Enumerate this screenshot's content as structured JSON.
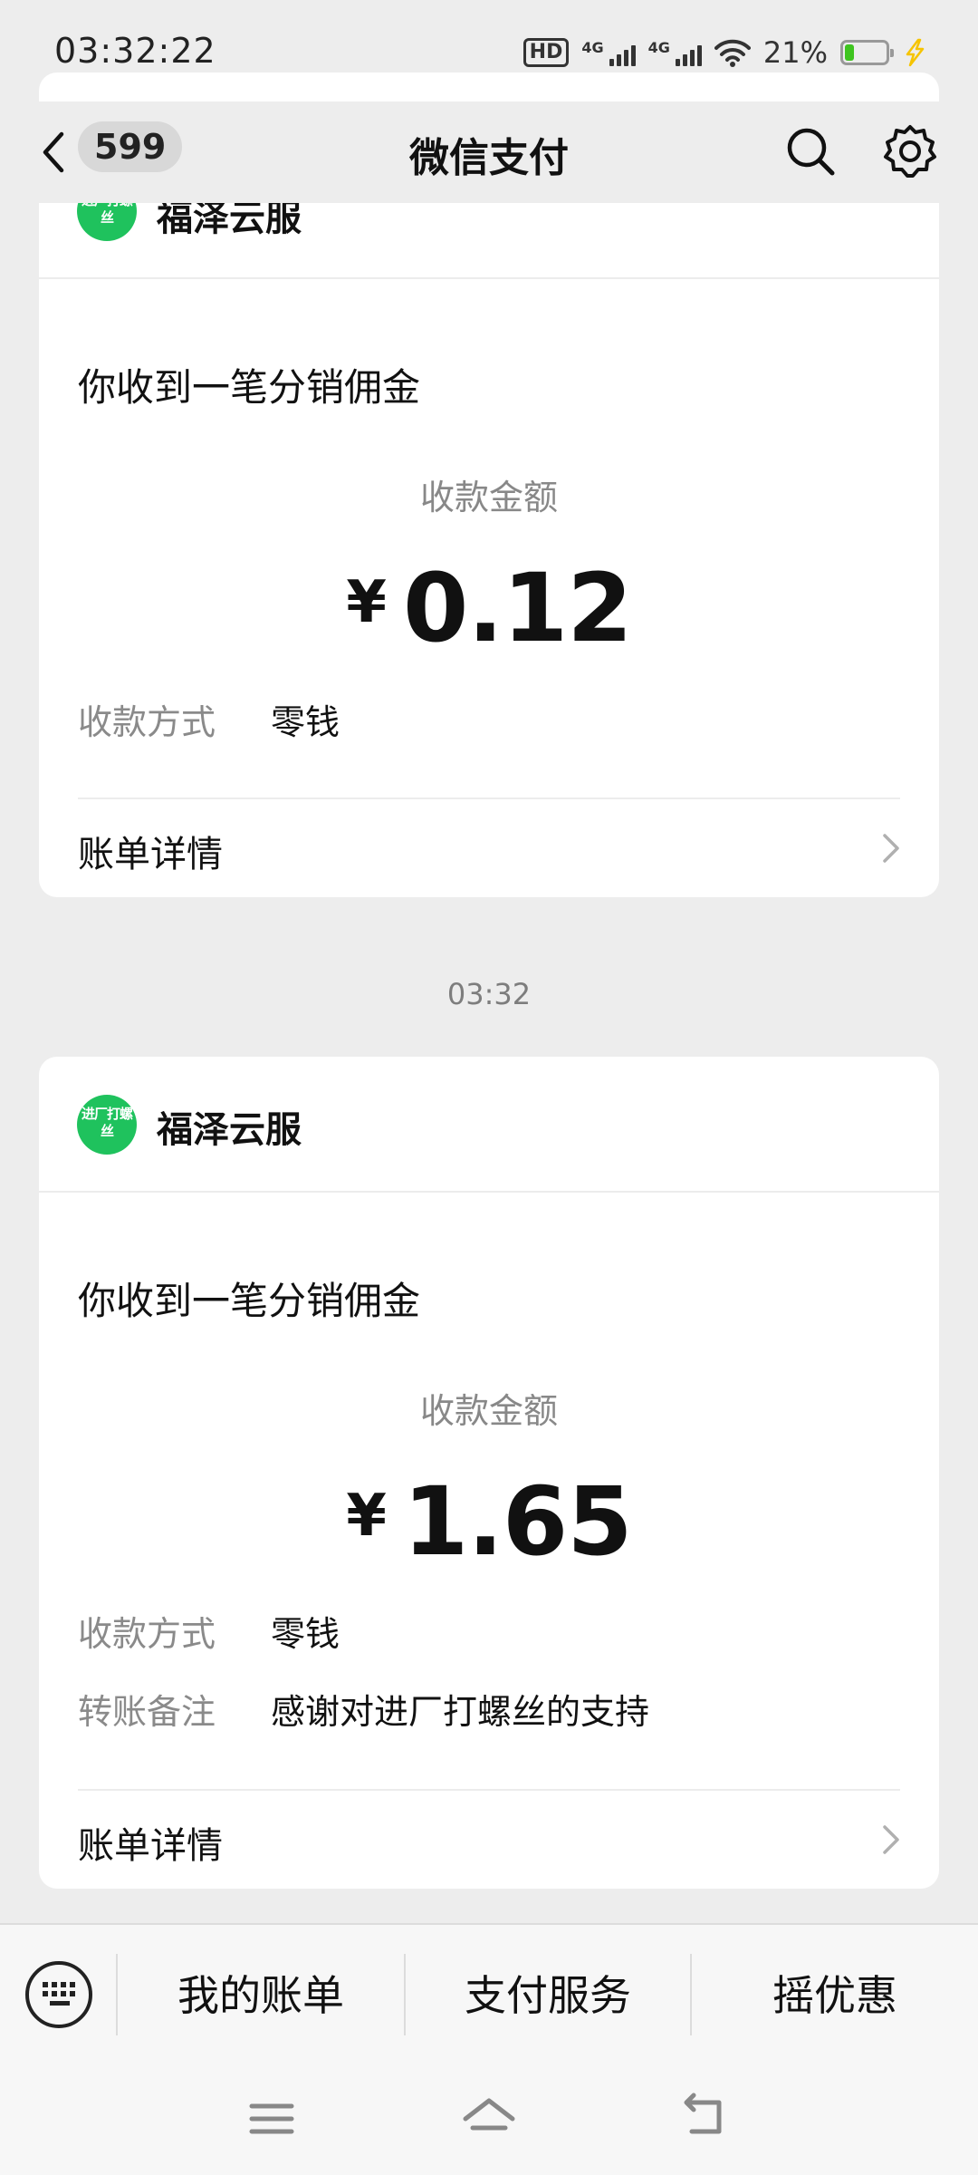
{
  "status_bar": {
    "time": "03:32:22",
    "hd_label": "HD",
    "net1": "4G",
    "net2": "4G",
    "battery_text": "21%",
    "battery_level": 0.21
  },
  "nav": {
    "back_count": "599",
    "title": "微信支付"
  },
  "cards": [
    {
      "merchant_logo_text": "进厂打螺丝",
      "merchant": "福泽云服",
      "title": "你收到一笔分销佣金",
      "amount_label": "收款金额",
      "currency": "¥",
      "amount": "0.12",
      "method_label": "收款方式",
      "method": "零钱",
      "detail_label": "账单详情"
    },
    {
      "merchant_logo_text": "进厂打螺丝",
      "merchant": "福泽云服",
      "title": "你收到一笔分销佣金",
      "amount_label": "收款金额",
      "currency": "¥",
      "amount": "1.65",
      "method_label": "收款方式",
      "method": "零钱",
      "note_label": "转账备注",
      "note": "感谢对进厂打螺丝的支持",
      "detail_label": "账单详情"
    }
  ],
  "time_separator": "03:32",
  "bottom_menu": [
    "我的账单",
    "支付服务",
    "摇优惠"
  ],
  "colors": {
    "background": "#ededed",
    "card": "#ffffff",
    "merchant_logo": "#1fc25d",
    "battery": "#3ec41f",
    "charge_bolt": "#f6c400"
  }
}
